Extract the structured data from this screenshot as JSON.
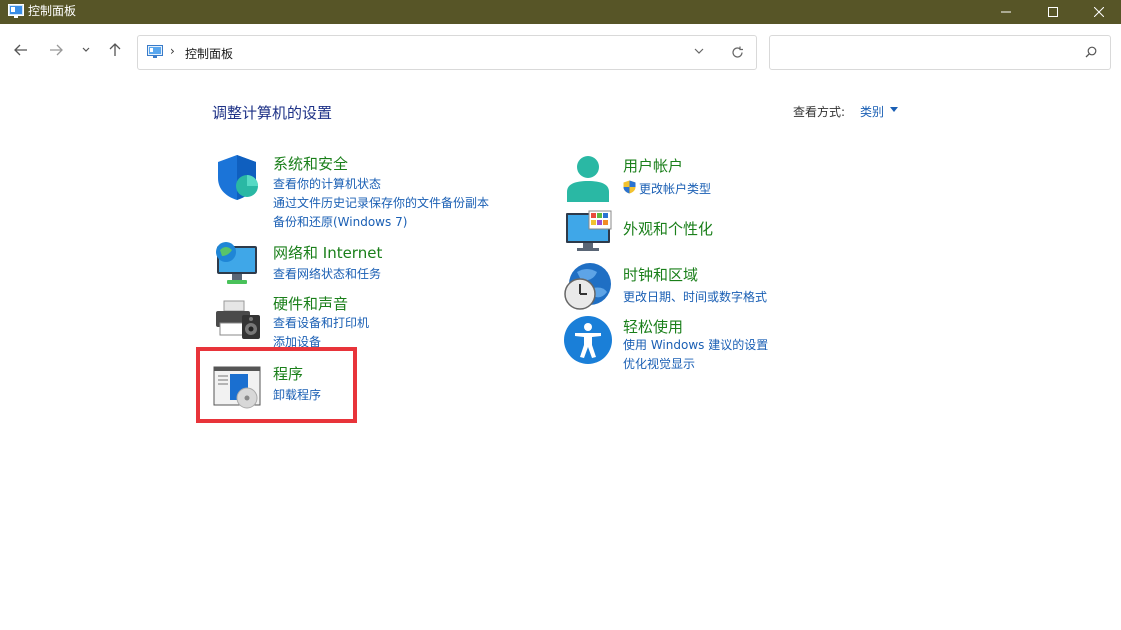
{
  "window": {
    "title": "控制面板",
    "title_bar_color": "#575527"
  },
  "address_bar": {
    "separator": "›",
    "breadcrumb": "控制面板"
  },
  "search": {
    "placeholder": ""
  },
  "main": {
    "heading": "调整计算机的设置",
    "view_by_label": "查看方式:",
    "view_by_value": "类别"
  },
  "categories_left": [
    {
      "title": "系统和安全",
      "icon": "security-shield-icon",
      "links": [
        "查看你的计算机状态",
        "通过文件历史记录保存你的文件备份副本",
        "备份和还原(Windows 7)"
      ]
    },
    {
      "title": "网络和 Internet",
      "icon": "network-icon",
      "links": [
        "查看网络状态和任务"
      ]
    },
    {
      "title": "硬件和声音",
      "icon": "printer-speaker-icon",
      "links": [
        "查看设备和打印机",
        "添加设备"
      ]
    },
    {
      "title": "程序",
      "icon": "programs-icon",
      "links": [
        "卸载程序"
      ]
    }
  ],
  "categories_right": [
    {
      "title": "用户帐户",
      "icon": "user-accounts-icon",
      "links": [
        "更改帐户类型"
      ]
    },
    {
      "title": "外观和个性化",
      "icon": "appearance-icon",
      "links": []
    },
    {
      "title": "时钟和区域",
      "icon": "clock-globe-icon",
      "links": [
        "更改日期、时间或数字格式"
      ]
    },
    {
      "title": "轻松使用",
      "icon": "accessibility-icon",
      "links": [
        "使用 Windows 建议的设置",
        "优化视觉显示"
      ]
    }
  ],
  "colors": {
    "category_title": "#1a7f1a",
    "link": "#1a5fb4",
    "heading": "#1e3287",
    "highlight": "#e8343a"
  }
}
